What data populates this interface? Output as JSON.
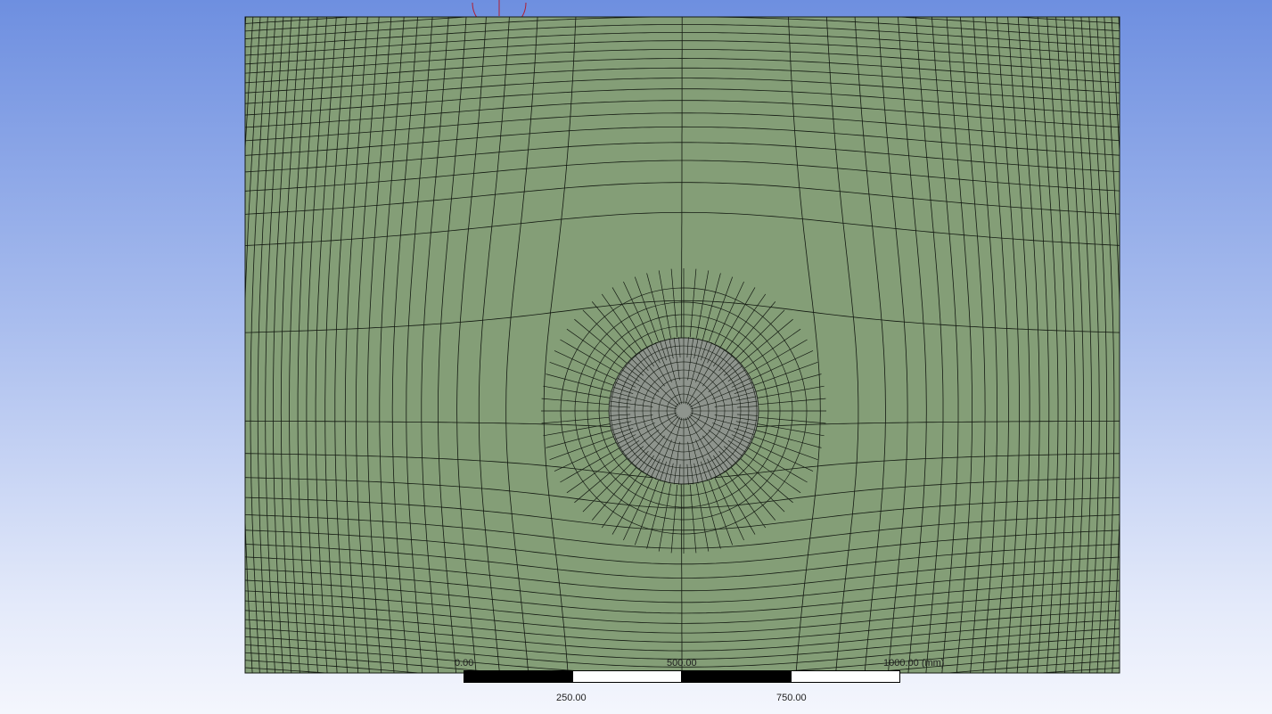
{
  "viewport": {
    "mesh_fill": "#849e77",
    "inner_fill": "#8e948d",
    "line_color": "#141a12",
    "triad_color": "#b01e32"
  },
  "scale": {
    "label_0": "0.00",
    "label_250": "250.00",
    "label_500": "500.00",
    "label_750": "750.00",
    "label_1000": "1000.00 (mm)"
  }
}
